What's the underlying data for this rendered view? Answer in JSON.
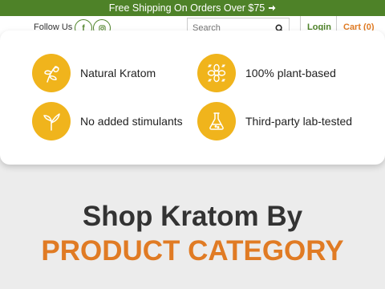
{
  "promo": {
    "text": "Free Shipping On Orders Over $75"
  },
  "header": {
    "follow_label": "Follow Us",
    "social": [
      "f",
      "ig"
    ],
    "search_placeholder": "Search",
    "login_label": "Login",
    "cart_label": "Cart (0)"
  },
  "features": [
    {
      "label": "Natural Kratom",
      "icon": "leaf-icon"
    },
    {
      "label": "100% plant-based",
      "icon": "flower-icon"
    },
    {
      "label": "No added stimulants",
      "icon": "sprout-icon"
    },
    {
      "label": "Third-party lab-tested",
      "icon": "flask-icon"
    }
  ],
  "section": {
    "title_line1": "Shop Kratom By",
    "title_line2": "PRODUCT CATEGORY"
  },
  "colors": {
    "brand_green": "#4e8228",
    "accent_orange": "#e07b24",
    "badge_yellow": "#f0b41c"
  }
}
